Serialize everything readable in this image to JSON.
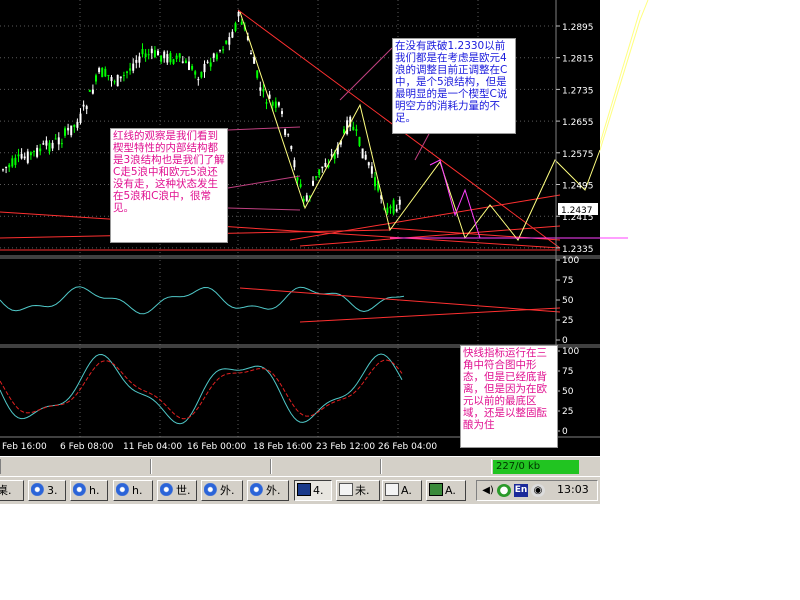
{
  "chart": {
    "price_axis": [
      "1.2895",
      "1.2815",
      "1.2735",
      "1.2655",
      "1.2575",
      "1.2495",
      "1.2415",
      "1.2335"
    ],
    "current_price": "1.2437",
    "indicator1_axis": [
      "100",
      "75",
      "50",
      "25",
      "0"
    ],
    "indicator2_axis": [
      "100",
      "75",
      "50",
      "25",
      "0"
    ],
    "date_axis": [
      "Feb 16:00",
      "6 Feb 08:00",
      "11 Feb 04:00",
      "16 Feb 00:00",
      "18 Feb 16:00",
      "23 Feb 12:00",
      "26 Feb 04:00"
    ],
    "colors": {
      "background": "#000000",
      "bull": "#00ff00",
      "bear": "#ffffff",
      "trendline": "#ff3030",
      "wave": "#ffff80",
      "projection": "#ff40ff",
      "indicator": "#50c8c8",
      "signal": "#e02020"
    }
  },
  "annotations": {
    "top": "在没有跌破1.2330以前我们都是在考虑是欧元4浪的调整目前正调整在C中，是个5浪结构，但是最明显的是一个楔型C说明空方的消耗力量的不足。",
    "left": "红线的观察是我们看到楔型特性的内部结构都是3浪结构也是我们了解C走5浪中和欧元5浪还没有走，这种状态发生在5浪和C浪中，很常见。",
    "right": "快线指标运行在三角中符合图中形态，但是已经底背离，但是因为在欧元以前的最底区域，还是以整固酝酿为住"
  },
  "status_bar": {
    "net": "227/0 kb"
  },
  "taskbar": {
    "buttons": [
      {
        "label": "桌."
      },
      {
        "label": "3."
      },
      {
        "label": "h."
      },
      {
        "label": "h."
      },
      {
        "label": "世."
      },
      {
        "label": "外."
      },
      {
        "label": "外."
      },
      {
        "label": "4."
      },
      {
        "label": "未."
      },
      {
        "label": "A."
      },
      {
        "label": "A."
      }
    ],
    "tray": {
      "lang": "En",
      "clock": "13:03"
    }
  }
}
